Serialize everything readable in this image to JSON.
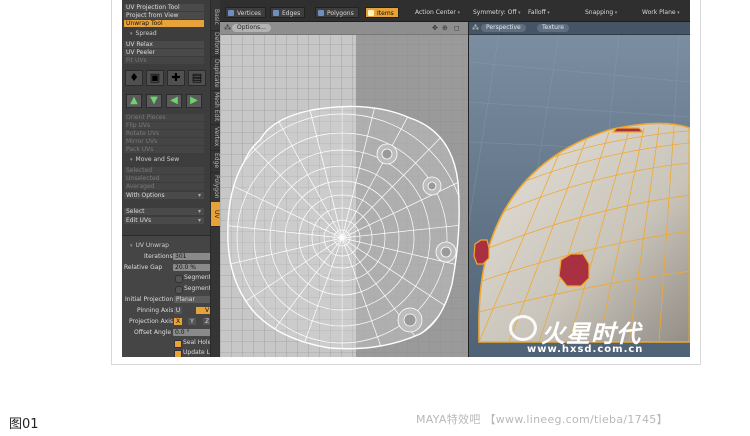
{
  "left_panel": {
    "top_items": [
      "UV Projection Tool",
      "Project from View",
      "Unwrap Tool"
    ],
    "spread_header": "Spread",
    "spread_items": [
      "UV Relax",
      "UV Peeler",
      "Fit UVs"
    ],
    "dim_items": [
      "Orient Pieces",
      "Flip UVs",
      "Rotate UVs",
      "Mirror UVs",
      "Pack UVs"
    ],
    "move_sew_header": "Move and Sew",
    "move_sew_items": [
      "Selected",
      "Unselected",
      "Averaged"
    ],
    "with_options": "With Options",
    "select_label": "Select",
    "edit_uvs_label": "Edit UVs"
  },
  "vertical_tabs": [
    "Basic",
    "Deform",
    "Duplicate",
    "Mesh Edit",
    "Vertex",
    "Edge",
    "Polygon",
    "UV"
  ],
  "uv_unwrap": {
    "header": "UV Unwrap",
    "iterations_label": "Iterations",
    "iterations_value": "301",
    "relative_gap_label": "Relative Gap",
    "relative_gap_value": "20.0 %",
    "segment_b1": "Segment b...",
    "segment_b2": "Segment b...",
    "initial_projection_label": "Initial Projection",
    "initial_projection_value": "Planar",
    "pinning_axis_label": "Pinning Axis",
    "pinning_axis_options": [
      "U",
      "V"
    ],
    "pinning_axis_selected": "V",
    "projection_axis_label": "Projection Axis",
    "projection_axis_options": [
      "X",
      "Y",
      "Z"
    ],
    "projection_axis_selected": "X",
    "offset_angle_label": "Offset Angle",
    "offset_angle_value": "0.0 °",
    "seal_holes": "Seal Holes",
    "update_layout": "Update La..."
  },
  "toolbar": {
    "modes": [
      "Vertices",
      "Edges",
      "Polygons",
      "Items"
    ],
    "active_mode": "Items",
    "action_center": "Action Center",
    "symmetry": "Symmetry: Off",
    "falloff": "Falloff",
    "snapping": "Snapping",
    "work_plane": "Work Plane"
  },
  "uv_viewport": {
    "options_label": "Options..."
  },
  "persp_viewport": {
    "tabs": [
      "Perspective",
      "Texture"
    ]
  },
  "watermark": {
    "brand": "火星时代",
    "url": "www.hxsd.com.cn"
  },
  "caption": "图01",
  "footer_text": "MAYA特效吧 【www.lineeg.com/tieba/1745】",
  "colors": {
    "accent": "#e8a23a",
    "panel": "#3d3d3d",
    "uv_bg": "#9a9a9a",
    "persp_bg": "#6a7f94"
  }
}
